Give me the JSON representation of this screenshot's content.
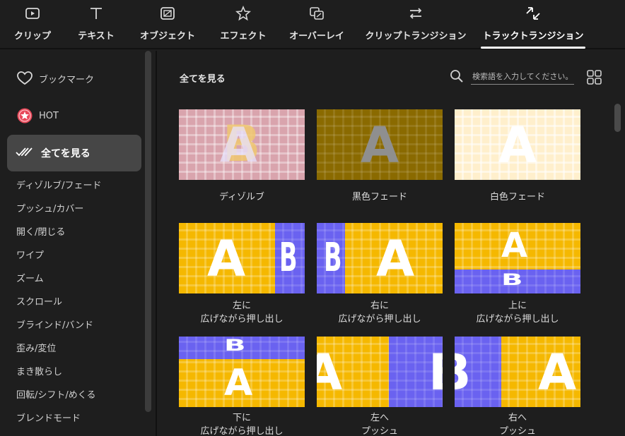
{
  "tabs": [
    {
      "label": "クリップ",
      "icon": "clip-icon",
      "active": false
    },
    {
      "label": "テキスト",
      "icon": "text-icon",
      "active": false
    },
    {
      "label": "オブジェクト",
      "icon": "object-icon",
      "active": false
    },
    {
      "label": "エフェクト",
      "icon": "effect-icon",
      "active": false
    },
    {
      "label": "オーバーレイ",
      "icon": "overlay-icon",
      "active": false
    },
    {
      "label": "クリップトランジション",
      "icon": "clip-transition-icon",
      "active": false
    },
    {
      "label": "トラックトランジション",
      "icon": "track-transition-icon",
      "active": true
    }
  ],
  "sidebar": {
    "bookmark": "ブックマーク",
    "hot": "HOT",
    "show_all": "全てを見る",
    "categories": [
      "ディゾルブ/フェード",
      "プッシュ/カバー",
      "開く/閉じる",
      "ワイプ",
      "ズーム",
      "スクロール",
      "ブラインド/バンド",
      "歪み/変位",
      "まき散らし",
      "回転/シフト/めくる",
      "ブレンドモード"
    ]
  },
  "main": {
    "title": "全てを見る",
    "search_placeholder": "検索語を入力してください。"
  },
  "items": [
    {
      "line1": "ディゾルブ",
      "line2": "",
      "thumb": "dissolve"
    },
    {
      "line1": "黒色フェード",
      "line2": "",
      "thumb": "fade-black"
    },
    {
      "line1": "白色フェード",
      "line2": "",
      "thumb": "fade-white"
    },
    {
      "line1": "左に",
      "line2": "広げながら押し出し",
      "thumb": "push-left"
    },
    {
      "line1": "右に",
      "line2": "広げながら押し出し",
      "thumb": "push-right"
    },
    {
      "line1": "上に",
      "line2": "広げながら押し出し",
      "thumb": "push-up"
    },
    {
      "line1": "下に",
      "line2": "広げながら押し出し",
      "thumb": "push-down"
    },
    {
      "line1": "左へ",
      "line2": "プッシュ",
      "thumb": "push-to-left"
    },
    {
      "line1": "右へ",
      "line2": "プッシュ",
      "thumb": "push-to-right"
    }
  ],
  "thumb_letters": {
    "a": "A",
    "b": "B"
  },
  "colors": {
    "accent": "#ffffff",
    "hot": "#e8495a",
    "yellow": "#f5b800",
    "purple": "#6a62f0"
  }
}
